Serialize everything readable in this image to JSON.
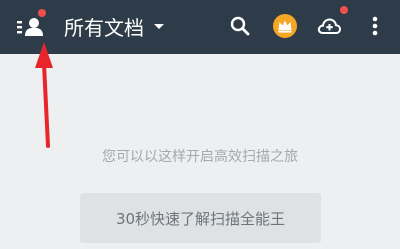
{
  "app_bar": {
    "title": "所有文档",
    "menu_icon": "user-menu-icon",
    "search_icon": "search-icon",
    "vip_icon": "crown-icon",
    "cloud_icon": "cloud-upload-icon",
    "more_icon": "more-vertical-icon"
  },
  "empty_state": {
    "prompt": "您可以以这样开启高效扫描之旅",
    "guide_button": "30秒快速了解扫描全能王"
  },
  "annotation": {
    "arrow_color": "#e8262a"
  },
  "colors": {
    "app_bar_bg": "#2e3c49",
    "page_bg": "#eeeff0",
    "badge_red": "#f0504c",
    "crown_gold": "#f5a623"
  }
}
